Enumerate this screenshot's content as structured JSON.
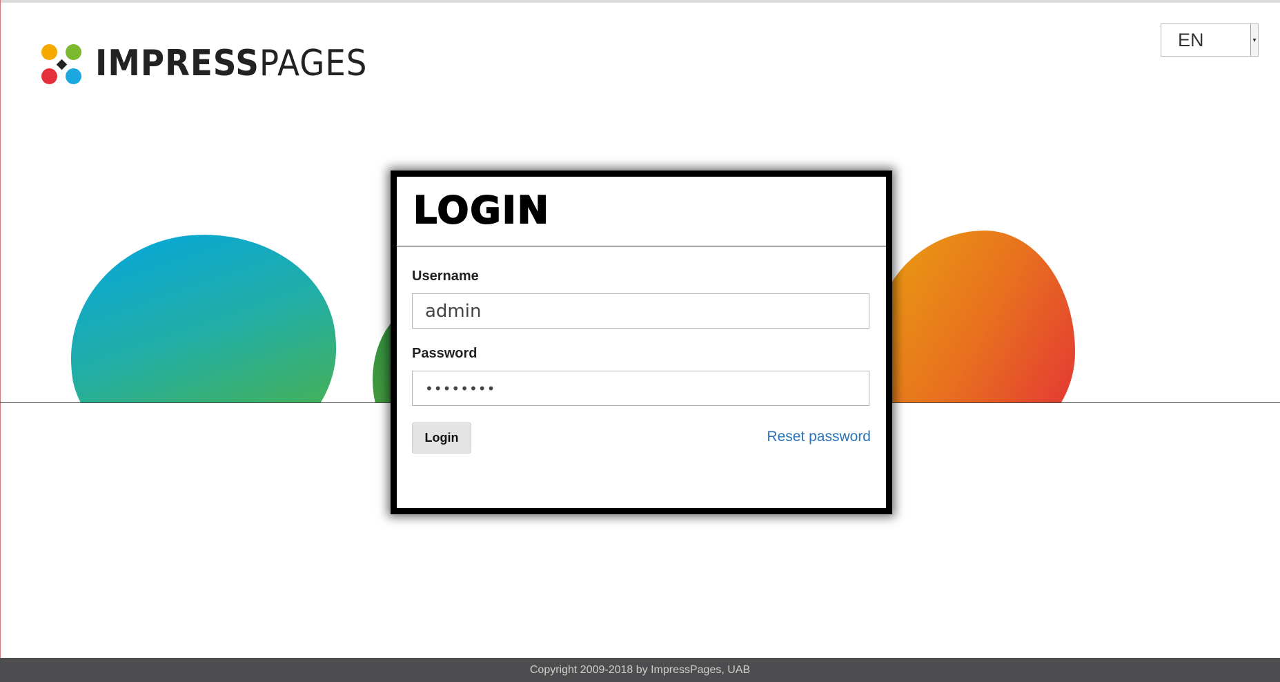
{
  "logo": {
    "text_bold": "IMPRESS",
    "text_regular": "PAGES"
  },
  "language": {
    "selected": "EN"
  },
  "login": {
    "title": "LOGIN",
    "username_label": "Username",
    "username_value": "admin",
    "password_label": "Password",
    "password_value": "••••••••",
    "login_button": "Login",
    "reset_link": "Reset password"
  },
  "footer": {
    "copyright": "Copyright 2009-2018 by ImpressPages, UAB"
  },
  "colors": {
    "logo_orange": "#f5a800",
    "logo_green": "#7cb82f",
    "logo_red": "#e5303b",
    "logo_blue": "#1ba8e0",
    "link": "#2a73b8",
    "footer_bg": "#4d4d4f"
  }
}
